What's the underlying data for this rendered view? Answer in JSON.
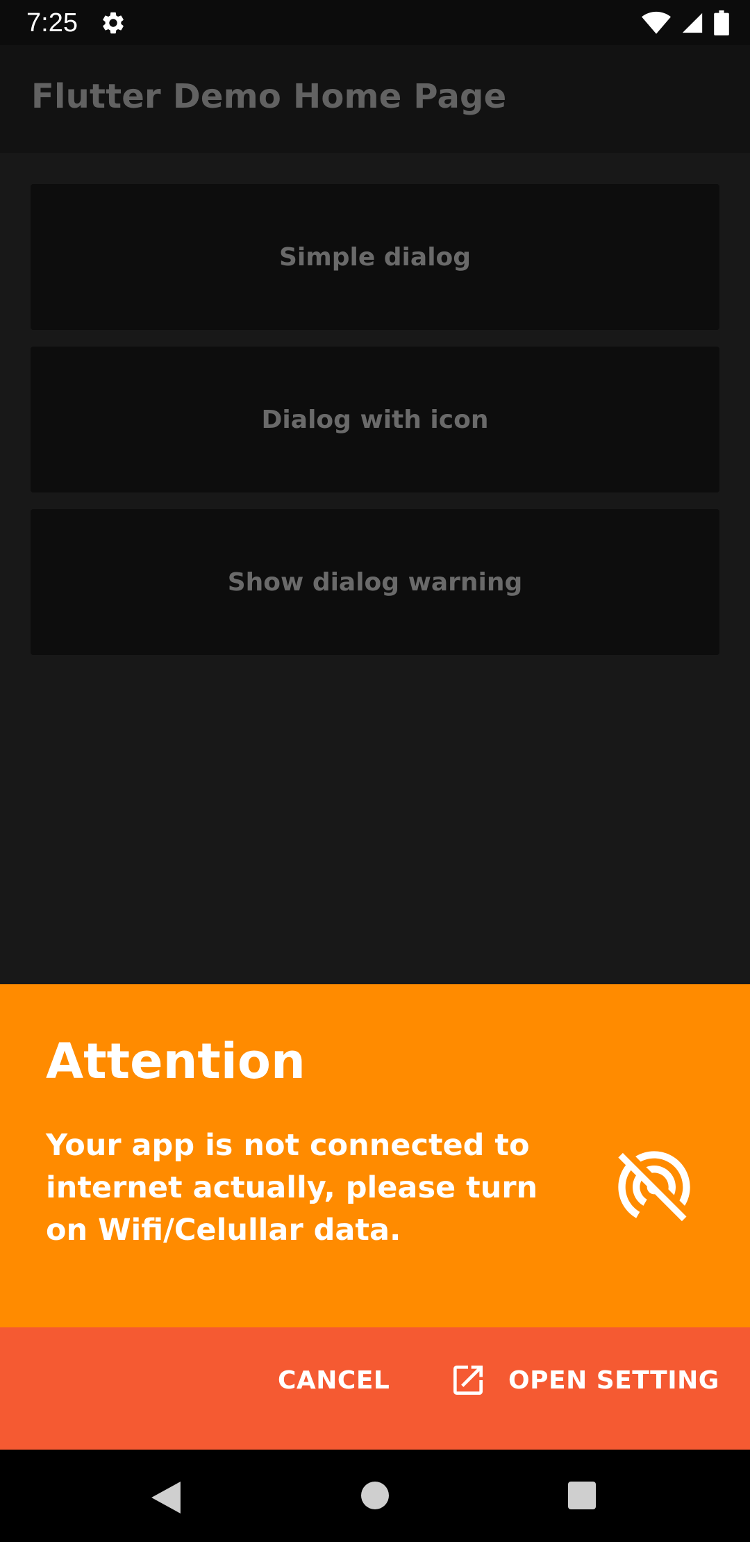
{
  "status_bar": {
    "time": "7:25",
    "icons": [
      "gear-icon",
      "wifi-icon",
      "signal-icon",
      "battery-icon"
    ]
  },
  "app_bar": {
    "title": "Flutter Demo Home Page"
  },
  "buttons": [
    {
      "label": "Simple dialog"
    },
    {
      "label": "Dialog with icon"
    },
    {
      "label": "Show dialog warning"
    }
  ],
  "dialog": {
    "title": "Attention",
    "message": "Your app is not connected to internet actually, please turn on Wifi/Celullar data.",
    "icon": "portable-wifi-off-icon",
    "cancel_label": "CANCEL",
    "open_setting_label": "OPEN SETTING",
    "open_setting_icon": "open-in-new-icon",
    "colors": {
      "body": "#ff8b00",
      "actions": "#f55a32"
    }
  },
  "nav_bar": {
    "icons": [
      "back-icon",
      "home-icon",
      "recents-icon"
    ]
  }
}
